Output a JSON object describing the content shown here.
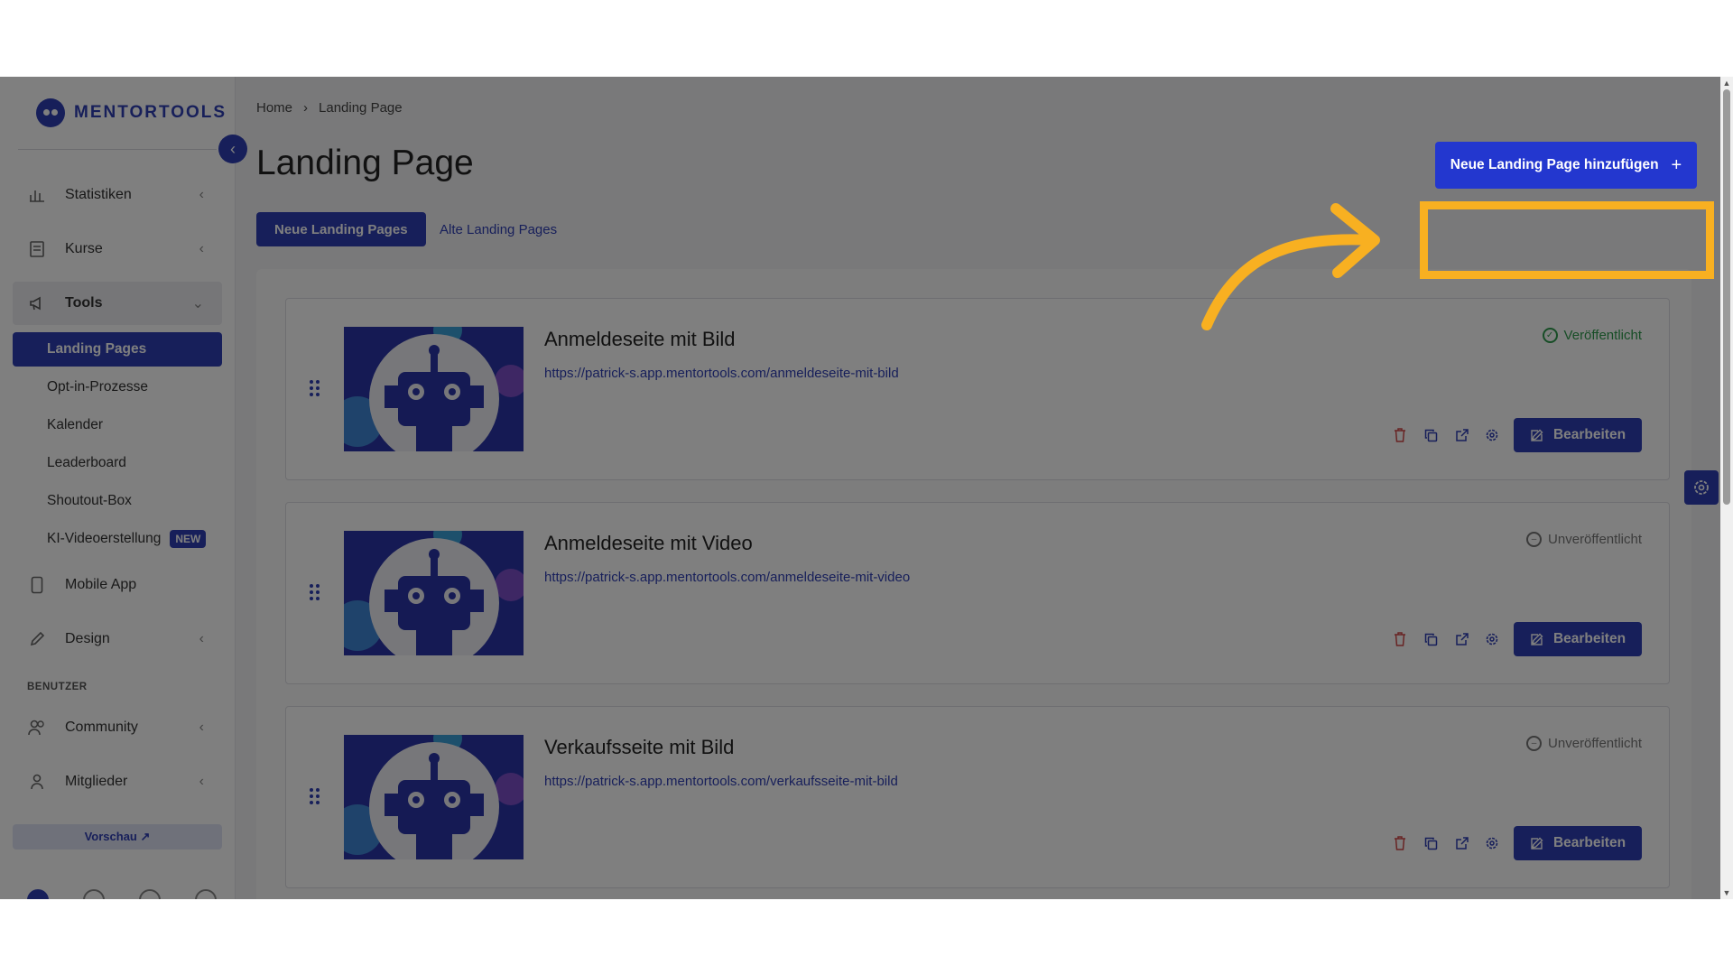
{
  "brand": {
    "name": "MENTORTOOLS"
  },
  "sidebar": {
    "items": [
      {
        "label": "Statistiken",
        "icon": "bar-chart-icon",
        "expanded": false
      },
      {
        "label": "Kurse",
        "icon": "book-icon",
        "expanded": false
      },
      {
        "label": "Tools",
        "icon": "megaphone-icon",
        "expanded": true
      }
    ],
    "tools_sub": [
      {
        "label": "Landing Pages",
        "current": true
      },
      {
        "label": "Opt-in-Prozesse"
      },
      {
        "label": "Kalender"
      },
      {
        "label": "Leaderboard"
      },
      {
        "label": "Shoutout-Box"
      },
      {
        "label": "KI-Videoerstellung",
        "badge": "NEW"
      }
    ],
    "more_items": [
      {
        "label": "Mobile App",
        "icon": "phone-icon"
      },
      {
        "label": "Design",
        "icon": "edit-icon"
      }
    ],
    "section_label": "BENUTZER",
    "user_items": [
      {
        "label": "Community",
        "icon": "users-icon"
      },
      {
        "label": "Mitglieder",
        "icon": "user-icon"
      }
    ],
    "preview_label": "Vorschau ↗"
  },
  "breadcrumb": {
    "home": "Home",
    "current": "Landing Page",
    "separator": "›"
  },
  "page": {
    "title": "Landing Page",
    "tabs": [
      {
        "label": "Neue Landing Pages",
        "active": true
      },
      {
        "label": "Alte Landing Pages",
        "active": false
      }
    ],
    "add_button": "Neue Landing Page hinzufügen",
    "add_button_icon": "+"
  },
  "landing_pages": [
    {
      "title": "Anmeldeseite mit Bild",
      "url": "https://patrick-s.app.mentortools.com/anmeldeseite-mit-bild",
      "status": "Veröffentlicht",
      "published": true,
      "edit_label": "Bearbeiten"
    },
    {
      "title": "Anmeldeseite mit Video",
      "url": "https://patrick-s.app.mentortools.com/anmeldeseite-mit-video",
      "status": "Unveröffentlicht",
      "published": false,
      "edit_label": "Bearbeiten"
    },
    {
      "title": "Verkaufsseite mit Bild",
      "url": "https://patrick-s.app.mentortools.com/verkaufsseite-mit-bild",
      "status": "Unveröffentlicht",
      "published": false,
      "edit_label": "Bearbeiten"
    }
  ],
  "colors": {
    "primary": "#2f3fb5",
    "highlight": "#f8b021",
    "published": "#2e9b4d",
    "delete": "#d04848"
  }
}
